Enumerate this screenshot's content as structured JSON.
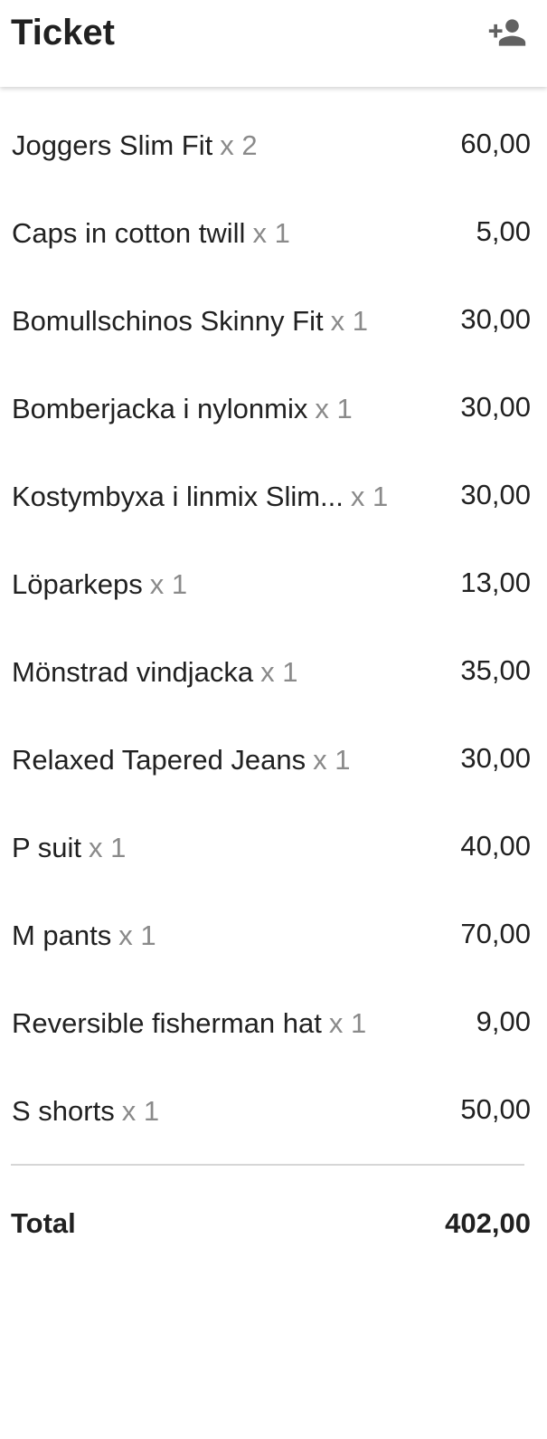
{
  "header": {
    "title": "Ticket",
    "add_customer_icon": "person-add-icon",
    "icon_color": "#616161"
  },
  "items": [
    {
      "name": "Joggers Slim Fit",
      "qty": "x 2",
      "price": "60,00"
    },
    {
      "name": "Caps in cotton twill",
      "qty": "x 1",
      "price": "5,00"
    },
    {
      "name": "Bomullschinos Skinny Fit",
      "qty": "x 1",
      "price": "30,00"
    },
    {
      "name": "Bomberjacka i nylonmix",
      "qty": "x 1",
      "price": "30,00"
    },
    {
      "name": "Kostymbyxa i linmix Slim...",
      "qty": "x 1",
      "price": "30,00"
    },
    {
      "name": "Löparkeps",
      "qty": "x 1",
      "price": "13,00"
    },
    {
      "name": "Mönstrad vindjacka",
      "qty": "x 1",
      "price": "35,00"
    },
    {
      "name": "Relaxed Tapered Jeans",
      "qty": "x 1",
      "price": "30,00"
    },
    {
      "name": "P suit",
      "qty": "x 1",
      "price": "40,00"
    },
    {
      "name": "M pants",
      "qty": "x 1",
      "price": "70,00"
    },
    {
      "name": "Reversible fisherman hat",
      "qty": "x 1",
      "price": "9,00"
    },
    {
      "name": "S shorts",
      "qty": "x 1",
      "price": "50,00"
    }
  ],
  "total": {
    "label": "Total",
    "value": "402,00"
  },
  "colors": {
    "text": "#212121",
    "qty_text": "#8a8a8a",
    "divider": "#d6d6d6"
  }
}
